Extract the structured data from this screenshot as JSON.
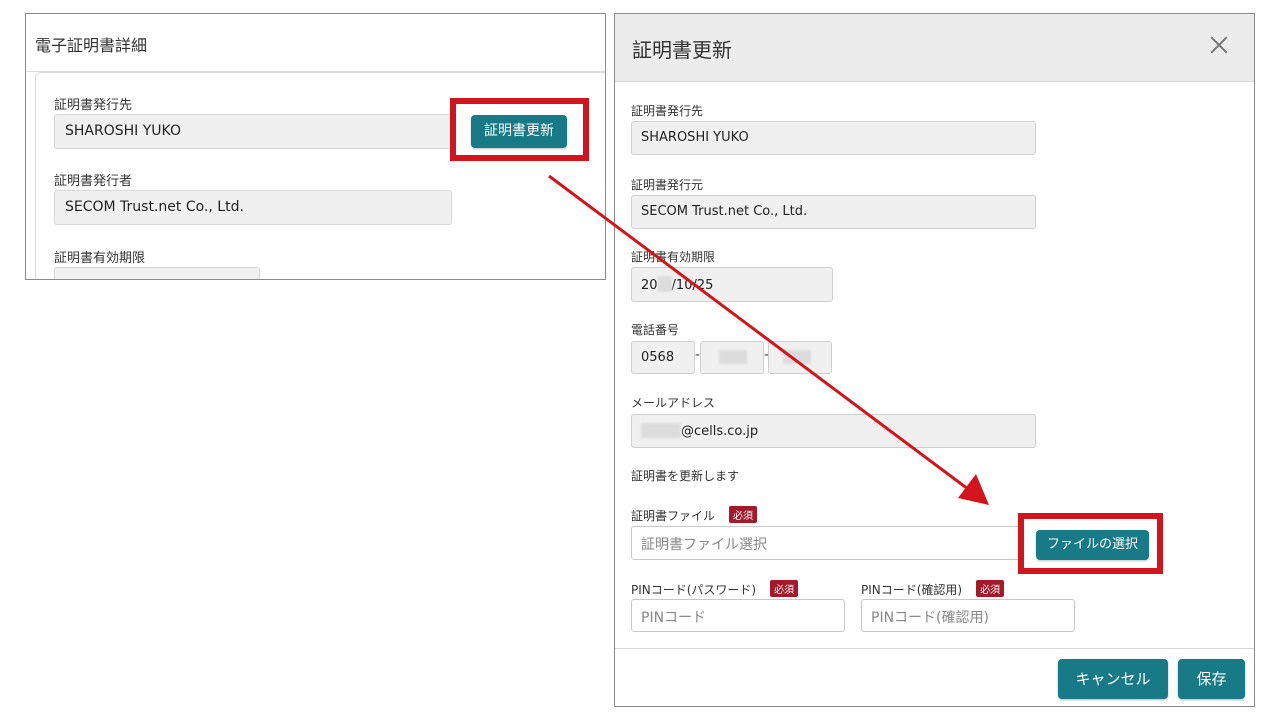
{
  "left": {
    "title": "電子証明書詳細",
    "issued_to_label": "証明書発行先",
    "issued_to_value": "SHAROSHI YUKO",
    "update_button": "証明書更新",
    "issuer_label": "証明書発行者",
    "issuer_value": "SECOM Trust.net Co., Ltd.",
    "expiry_label": "証明書有効期限"
  },
  "modal": {
    "title": "証明書更新",
    "issued_to_label": "証明書発行先",
    "issued_to_value": "SHAROSHI YUKO",
    "issuer_label": "証明書発行元",
    "issuer_value": "SECOM Trust.net Co., Ltd.",
    "expiry_label": "証明書有効期限",
    "expiry_prefix": "20",
    "expiry_suffix": "/10/25",
    "phone_label": "電話番号",
    "phone_part1": "0568",
    "phone_separator": "-",
    "email_label": "メールアドレス",
    "email_domain": "@cells.co.jp",
    "update_message": "証明書を更新します",
    "cert_file_label": "証明書ファイル",
    "required_badge": "必須",
    "cert_file_placeholder": "証明書ファイル選択",
    "file_select_button": "ファイルの選択",
    "pin_label": "PINコード(パスワード)",
    "pin_placeholder": "PINコード",
    "pin_confirm_label": "PINコード(確認用)",
    "pin_confirm_placeholder": "PINコード(確認用)",
    "cancel_button": "キャンセル",
    "save_button": "保存"
  },
  "colors": {
    "accent": "#177a86",
    "highlight": "#d2141c",
    "required": "#a51a2b"
  }
}
